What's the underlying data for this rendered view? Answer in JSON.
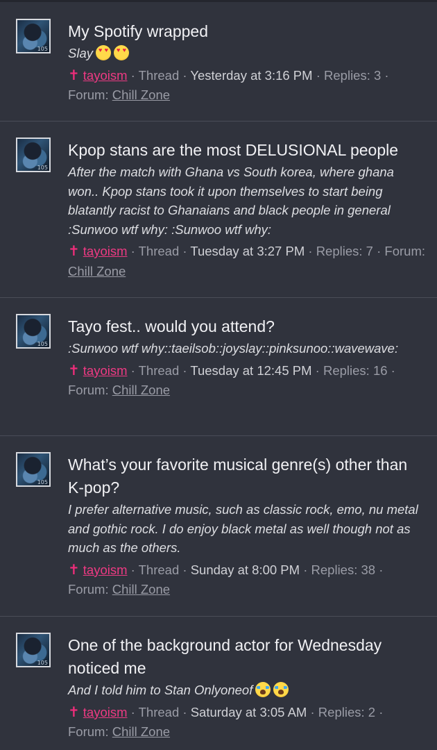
{
  "posts": [
    {
      "title": "My Spotify wrapped",
      "snippet": "Slay",
      "snippet_emojis": [
        "heart-eyes-emoji",
        "heart-eyes-emoji"
      ],
      "author": "tayoism",
      "type": "Thread",
      "date": "Yesterday at 3:16 PM",
      "replies": "Replies: 3",
      "forum_label": "Forum:",
      "forum": "Chill Zone"
    },
    {
      "title": "Kpop stans are the most DELUSIONAL people",
      "snippet": "After the match with Ghana vs South korea, where ghana won.. Kpop stans took it upon themselves to start being blatantly racist to Ghanaians and black people in general :Sunwoo wtf why: :Sunwoo wtf why:",
      "author": "tayoism",
      "type": "Thread",
      "date": "Tuesday at 3:27 PM",
      "replies": "Replies: 7",
      "forum_label": "Forum:",
      "forum": "Chill Zone"
    },
    {
      "title": "Tayo fest.. would you attend?",
      "snippet": ":Sunwoo wtf why::taeilsob::joyslay::pinksunoo::wavewave:",
      "author": "tayoism",
      "type": "Thread",
      "date": "Tuesday at 12:45 PM",
      "replies": "Replies: 16",
      "forum_label": "Forum:",
      "forum": "Chill Zone"
    },
    {
      "title": "What’s your favorite musical genre(s) other than K-pop?",
      "snippet": "I prefer alternative music, such as classic rock, emo, nu metal and gothic rock. I do enjoy black metal as well though not as much as the others.",
      "author": "tayoism",
      "type": "Thread",
      "date": "Sunday at 8:00 PM",
      "replies": "Replies: 38",
      "forum_label": "Forum:",
      "forum": "Chill Zone"
    },
    {
      "title": "One of the background actor for Wednesday noticed me",
      "snippet": "And I told him to Stan Onlyoneof",
      "snippet_emojis": [
        "crying-emoji",
        "crying-emoji"
      ],
      "author": "tayoism",
      "type": "Thread",
      "date": "Saturday at 3:05 AM",
      "replies": "Replies: 2",
      "forum_label": "Forum:",
      "forum": "Chill Zone"
    }
  ],
  "avatar_tag": "105",
  "colors": {
    "background": "#30333d",
    "author": "#ee3a83",
    "muted": "#9a9ca6"
  }
}
